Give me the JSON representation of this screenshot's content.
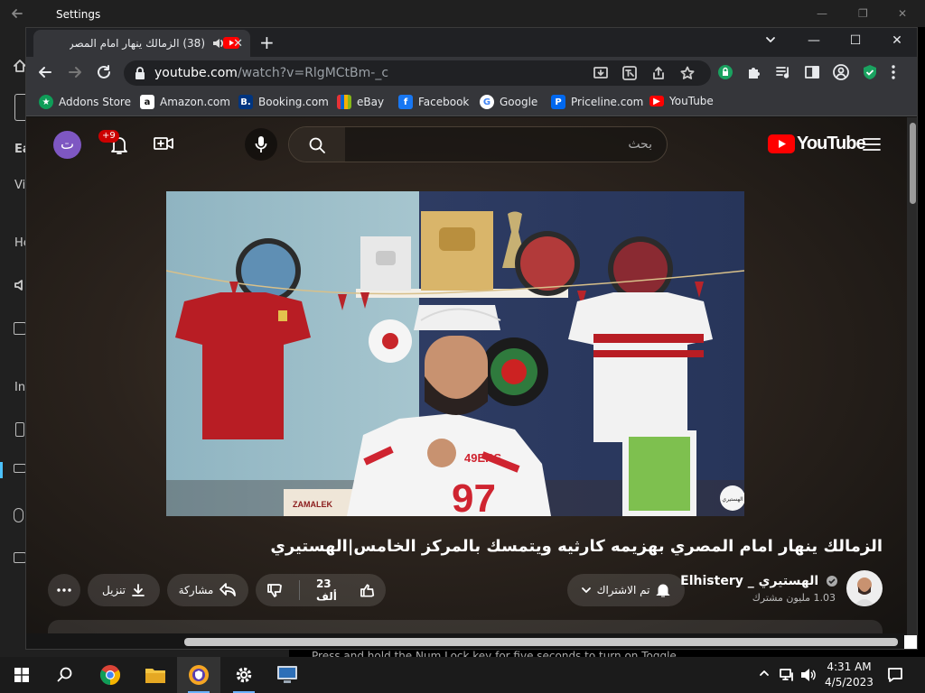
{
  "background": {
    "settings_title": "Settings",
    "sidebar_fragments": [
      "Ea",
      "Vi",
      "He",
      "In"
    ]
  },
  "tab": {
    "title": "(38) الزمالك ينهار امام المصري"
  },
  "address": {
    "host": "youtube.com",
    "path": "/watch?v=RlgMCtBm-_c"
  },
  "bookmarks": [
    {
      "label": "Addons Store",
      "icon": "addons-store-icon",
      "color": "#0f9d58"
    },
    {
      "label": "Amazon.com",
      "icon": "amazon-icon",
      "color": "#ffffff"
    },
    {
      "label": "Booking.com",
      "icon": "booking-icon",
      "color": "#003580"
    },
    {
      "label": "eBay",
      "icon": "ebay-icon",
      "color": "#e53238"
    },
    {
      "label": "Facebook",
      "icon": "facebook-icon",
      "color": "#1877f2"
    },
    {
      "label": "Google",
      "icon": "google-icon",
      "color": "#ffffff"
    },
    {
      "label": "Priceline.com",
      "icon": "priceline-icon",
      "color": "#0068ef"
    },
    {
      "label": "YouTube",
      "icon": "youtube-icon",
      "color": "#ff0000"
    }
  ],
  "youtube": {
    "avatar_letter": "ت",
    "notification_count": "+9",
    "search_placeholder": "بحث",
    "logo_text": "YouTube",
    "brand_color": "#ff0000",
    "video_title": "الزمالك ينهار امام المصري بهزيمه كارثيه ويتمسك بالمركز الخامس|الهستيري",
    "channel_name": "الهستيري _ Elhistery",
    "subscribers": "1.03 مليون مشترك",
    "subscribe_label": "تم الاشتراك",
    "like_count": "23 ألف",
    "share_label": "مشاركة",
    "download_label": "تنزيل",
    "player_watermark": "الهستيري",
    "player_scene": {
      "left_jersey_color": "#b81d24",
      "right_jersey_color": "#f2f2f2",
      "presenter_shirt_text": "49ERS",
      "presenter_number": "97",
      "banner_text": "ZAMALEK"
    }
  },
  "background_hint": "Press and hold the Num Lock key for five seconds to turn on Toggle",
  "taskbar": {
    "time": "4:31 AM",
    "date": "4/5/2023"
  }
}
